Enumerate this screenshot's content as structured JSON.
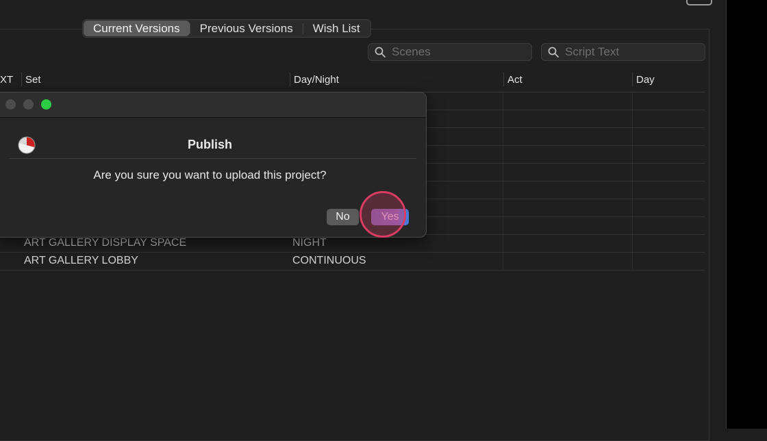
{
  "tabs": [
    {
      "label": "Current Versions",
      "active": true
    },
    {
      "label": "Previous Versions",
      "active": false
    },
    {
      "label": "Wish List",
      "active": false
    }
  ],
  "search": {
    "scenes_placeholder": "Scenes",
    "script_placeholder": "Script Text"
  },
  "table": {
    "columns": [
      "XT",
      "Set",
      "Day/Night",
      "Act",
      "Day"
    ],
    "rows": [
      {
        "set": "ART GALLERY DISPLAY SPACE",
        "day_night": "NIGHT"
      },
      {
        "set": "ART GALLERY LOBBY",
        "day_night": "CONTINUOUS"
      }
    ]
  },
  "dialog": {
    "title": "Publish",
    "message": "Are you sure you want to upload this project?",
    "no_label": "No",
    "yes_label": "Yes"
  },
  "colors": {
    "accent_green": "#2ecb45",
    "click_highlight": "#d83c63",
    "yes_button": "#8b5fb0"
  }
}
